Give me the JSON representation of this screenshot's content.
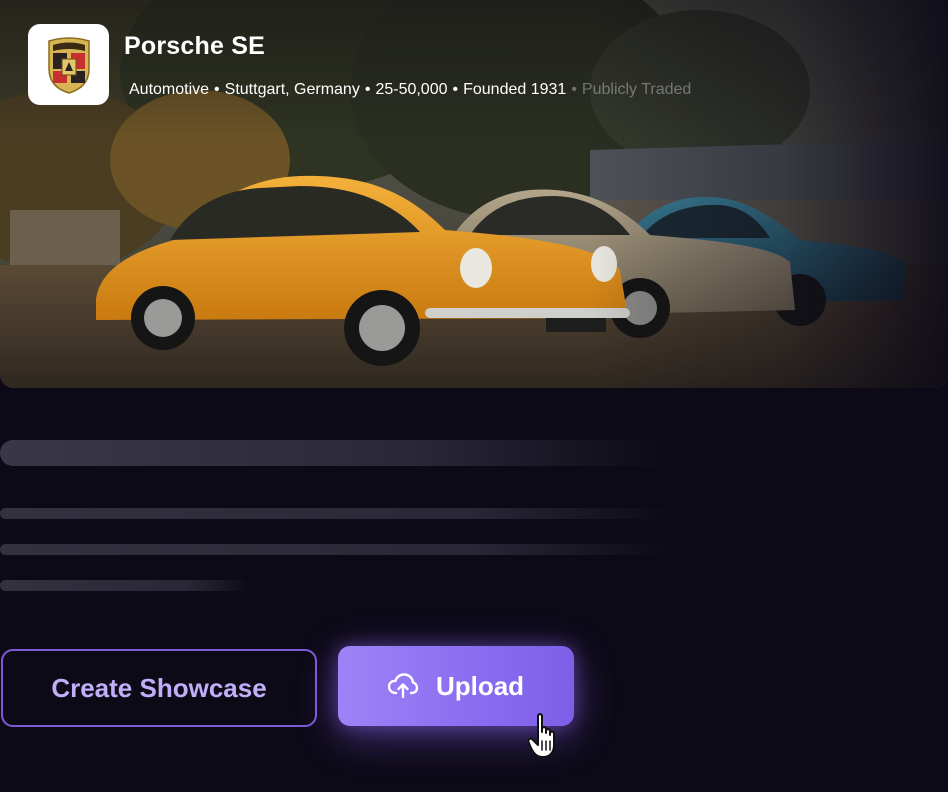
{
  "company": {
    "name": "Porsche SE",
    "logo_icon": "porsche-crest-icon",
    "meta": {
      "industry": "Automotive",
      "location": "Stuttgart, Germany",
      "employees": "25-50,000",
      "founded": "Founded 1931",
      "status": "Publicly Traded",
      "separator": "•"
    }
  },
  "hero": {
    "image": "classic-porsche-911-cars-photo"
  },
  "actions": {
    "create_label": "Create Showcase",
    "upload_label": "Upload",
    "upload_icon": "cloud-upload-icon"
  },
  "cursor_icon": "hand-pointer-icon",
  "colors": {
    "background": "#0d0a17",
    "accent": "#8a6cf0",
    "accent_border": "#7f5bd8",
    "outline_text": "#c1aef8"
  }
}
